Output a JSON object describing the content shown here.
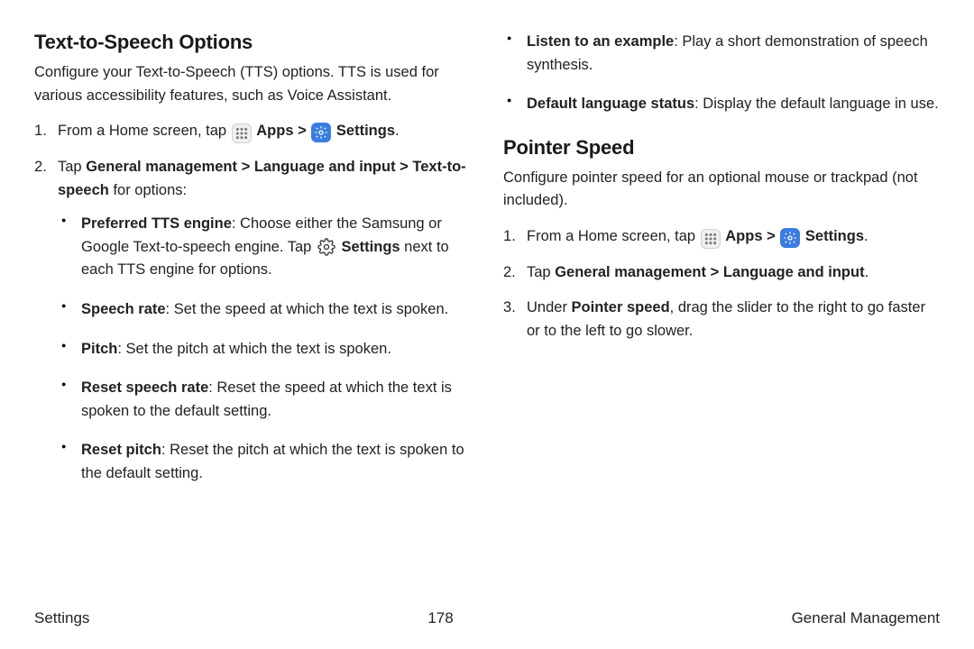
{
  "left": {
    "heading": "Text-to-Speech Options",
    "intro": "Configure your Text-to-Speech (TTS) options. TTS is used for various accessibility features, such as Voice Assistant.",
    "step1_pre": "From a Home screen, tap ",
    "apps": "Apps",
    "chev": ">",
    "settings": "Settings",
    "period": ".",
    "step2_a": "Tap ",
    "step2_b": "General management",
    "step2_c": "Language and input",
    "step2_d": "Text-to-speech",
    "step2_e": " for options:",
    "bullets": {
      "b1_a": "Preferred TTS engine",
      "b1_b": ": Choose either the Samsung or Google Text-to-speech engine. Tap ",
      "b1_c": "Settings",
      "b1_d": " next to each TTS engine for options.",
      "b2_a": "Speech rate",
      "b2_b": ": Set the speed at which the text is spoken.",
      "b3_a": "Pitch",
      "b3_b": ": Set the pitch at which the text is spoken.",
      "b4_a": "Reset speech rate",
      "b4_b": ": Reset the speed at which the text is spoken to the default setting.",
      "b5_a": "Reset pitch",
      "b5_b": ": Reset the pitch at which the text is spoken to the default setting."
    }
  },
  "right": {
    "cont": {
      "b6_a": "Listen to an example",
      "b6_b": ": Play a short demonstration of speech synthesis.",
      "b7_a": "Default language status",
      "b7_b": ": Display the default language in use."
    },
    "heading2": "Pointer Speed",
    "intro2": "Configure pointer speed for an optional mouse or trackpad (not included).",
    "step1_pre": "From a Home screen, tap ",
    "apps": "Apps",
    "chev": ">",
    "settings": "Settings",
    "period": ".",
    "step2_a": "Tap ",
    "step2_b": "General management",
    "step2_c": "Language and input",
    "step3_a": "Under ",
    "step3_b": "Pointer speed",
    "step3_c": ", drag the slider to the right to go faster or to the left to go slower."
  },
  "footer": {
    "left": "Settings",
    "center": "178",
    "right": "General Management"
  }
}
